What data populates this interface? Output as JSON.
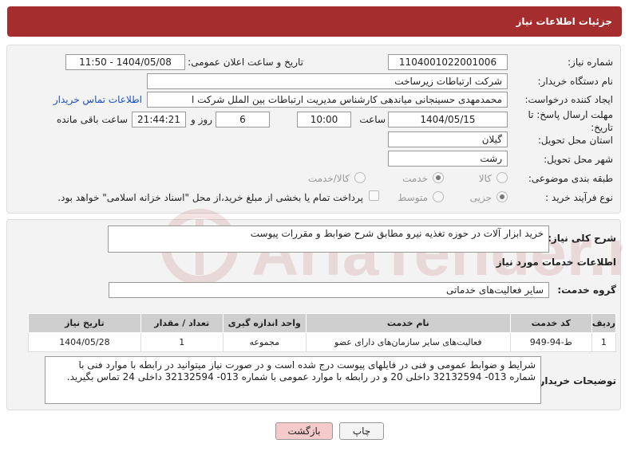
{
  "header": {
    "title": "جزئیات اطلاعات نیاز"
  },
  "form": {
    "need_number_label": "شماره نیاز:",
    "need_number": "1104001022001006",
    "announce_label": "تاریخ و ساعت اعلان عمومی:",
    "announce_value": "1404/05/08 - 11:50",
    "buyer_org_label": "نام دستگاه خریدار:",
    "buyer_org": "شرکت ارتباطات زیرساخت",
    "creator_label": "ایجاد کننده درخواست:",
    "creator": "محمدمهدی حسینجانی میاندهی کارشناس مدیریت ارتباطات بین الملل شرکت ا",
    "contact_link": "اطلاعات تماس خریدار",
    "deadline_label_1": "مهلت ارسال پاسخ: تا",
    "deadline_label_2": "تاریخ:",
    "deadline_date": "1404/05/15",
    "time_label": "ساعت",
    "deadline_time": "10:00",
    "days_value": "6",
    "days_label": "روز و",
    "remaining_time": "21:44:21",
    "remaining_label": "ساعت باقی مانده",
    "province_label": "استان محل تحویل:",
    "province": "گیلان",
    "city_label": "شهر محل تحویل:",
    "city": "رشت",
    "category_label": "طبقه بندی موضوعی:",
    "category_options": [
      "کالا",
      "خدمت",
      "کالا/خدمت"
    ],
    "category_selected": "خدمت",
    "purchase_type_label": "نوع فرآیند خرید :",
    "purchase_options": [
      "جزیی",
      "متوسط"
    ],
    "purchase_selected": "جزیی",
    "treasury_note": "پرداخت تمام یا بخشی از مبلغ خرید،از محل \"اسناد خزانه اسلامی\" خواهد بود."
  },
  "details": {
    "summary_label": "شرح کلی نیاز:",
    "summary": "خرید ابزار آلات در حوزه تغذیه نیرو مطابق شرح ضوابط و مقررات پیوست",
    "services_title": "اطلاعات خدمات مورد نیاز",
    "service_group_label": "گروه خدمت:",
    "service_group": "سایر فعالیت‌های خدماتی",
    "table": {
      "headers": [
        "ردیف",
        "کد خدمت",
        "نام خدمت",
        "واحد اندازه گیری",
        "تعداد / مقدار",
        "تاریخ نیاز"
      ],
      "rows": [
        [
          "1",
          "ط-94-949",
          "فعالیت‌های سایر سازمان‌های دارای عضو",
          "مجموعه",
          "1",
          "1404/05/28"
        ]
      ]
    },
    "buyer_notes_label": "توضیحات خریدار:",
    "buyer_notes": "شرایط و ضوابط عمومی و فنی در فایلهای پیوست درج شده است و در صورت نیاز میتوانید در رابطه با موارد فنی با شماره 013- 32132594 داخلی 20 و در رابطه با موارد عمومی با شماره 013- 32132594 داخلی 24 تماس  بگیرید."
  },
  "buttons": {
    "print": "چاپ",
    "back": "بازگشت"
  },
  "watermark": {
    "text": "AriaTender.neT"
  },
  "colors": {
    "header": "#a62d2d",
    "link": "#1a4fc4",
    "back_button": "#f4caca"
  }
}
